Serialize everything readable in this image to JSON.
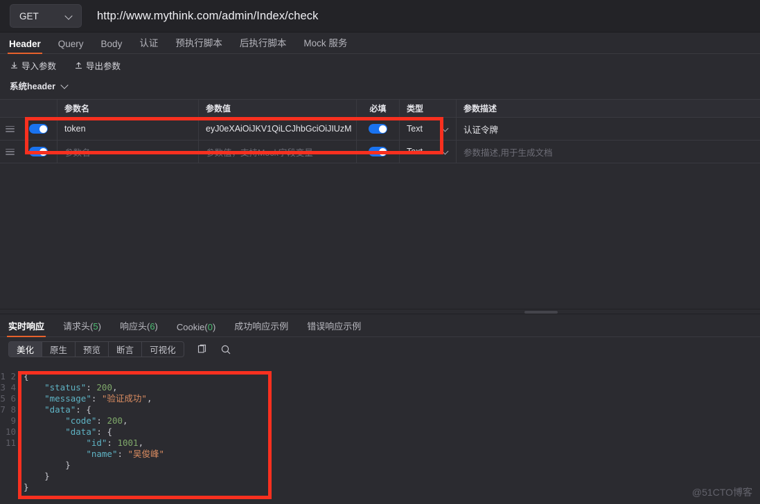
{
  "urlbar": {
    "method": "GET",
    "url": "http://www.mythink.com/admin/Index/check"
  },
  "request_tabs": [
    {
      "label": "Header",
      "active": true
    },
    {
      "label": "Query",
      "active": false
    },
    {
      "label": "Body",
      "active": false
    },
    {
      "label": "认证",
      "active": false
    },
    {
      "label": "预执行脚本",
      "active": false
    },
    {
      "label": "后执行脚本",
      "active": false
    },
    {
      "label": "Mock 服务",
      "active": false
    }
  ],
  "toolbar": {
    "import_label": "导入参数",
    "export_label": "导出参数",
    "system_header_label": "系统header"
  },
  "param_table": {
    "columns": [
      "参数名",
      "参数值",
      "必填",
      "类型",
      "参数描述"
    ],
    "rows": [
      {
        "enabled": true,
        "name": "token",
        "value": "eyJ0eXAiOiJKV1QiLCJhbGciOiJIUzM",
        "required": true,
        "type": "Text",
        "desc": "认证令牌",
        "placeholder_row": false
      },
      {
        "enabled": true,
        "name": "参数名",
        "value": "参数值，支持Mock字段变量",
        "required": true,
        "type": "Text",
        "desc": "参数描述,用于生成文档",
        "placeholder_row": true
      }
    ]
  },
  "response_tabs": [
    {
      "label": "实时响应",
      "count": null,
      "active": true
    },
    {
      "label": "请求头",
      "count": "5",
      "active": false
    },
    {
      "label": "响应头",
      "count": "6",
      "active": false
    },
    {
      "label": "Cookie",
      "count": "0",
      "active": false
    },
    {
      "label": "成功响应示例",
      "count": null,
      "active": false
    },
    {
      "label": "错误响应示例",
      "count": null,
      "active": false
    }
  ],
  "view_modes": [
    {
      "label": "美化",
      "active": true
    },
    {
      "label": "原生",
      "active": false
    },
    {
      "label": "预览",
      "active": false
    },
    {
      "label": "断言",
      "active": false
    },
    {
      "label": "可视化",
      "active": false
    }
  ],
  "view_icons": [
    "copy-icon",
    "search-icon"
  ],
  "response_body": {
    "line_numbers": "1\n2\n3\n4\n5\n6\n7\n8\n9\n10\n11",
    "json": {
      "status": 200,
      "message": "验证成功",
      "data": {
        "code": 200,
        "data": {
          "id": 1001,
          "name": "吴俊峰"
        }
      }
    }
  },
  "watermark": "@51CTO博客",
  "colors": {
    "accent": "#e8622c",
    "toggle_on": "#1a73f0",
    "annotation": "#f8301f",
    "count_green": "#4cbb72",
    "json_key": "#5fb3c4",
    "json_number": "#7fa86a",
    "json_string": "#d98b60"
  }
}
